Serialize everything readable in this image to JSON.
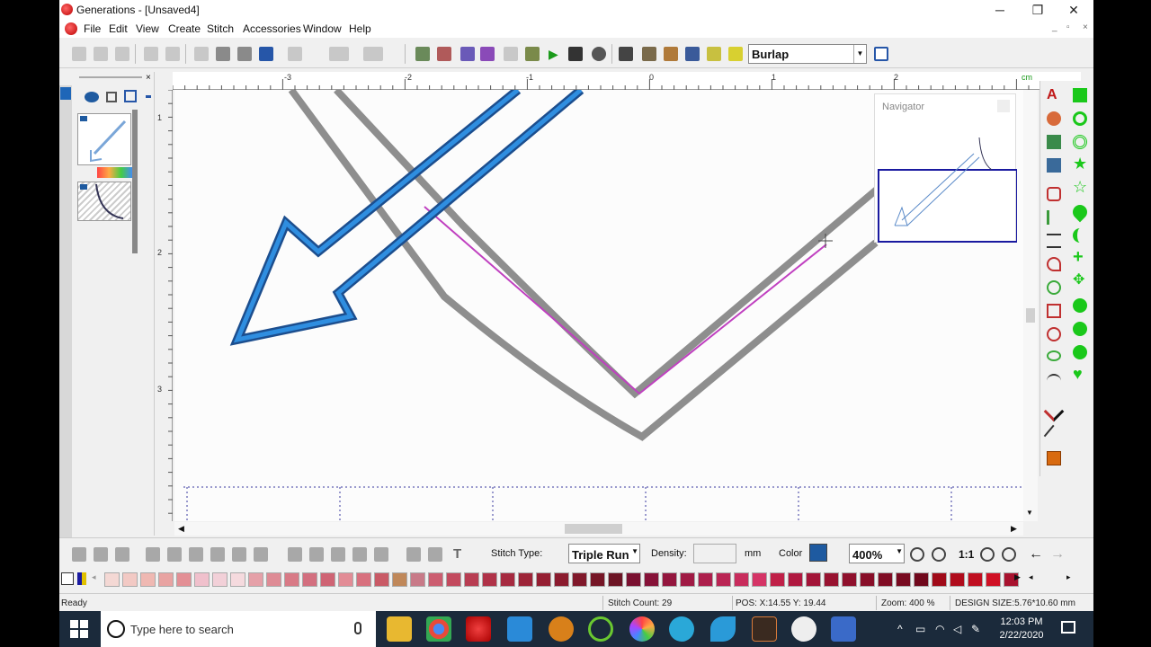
{
  "window": {
    "title": "Generations - [Unsaved4]",
    "minimize": "─",
    "maximize": "❐",
    "close": "✕"
  },
  "menu": [
    "File",
    "Edit",
    "View",
    "Create",
    "Stitch",
    "Accessories",
    "Window",
    "Help"
  ],
  "mdi_controls": [
    "_",
    "▫",
    "×"
  ],
  "toolbar": {
    "fabric_value": "Burlap"
  },
  "ruler": {
    "h_labels": [
      "-3",
      "-2",
      "-1",
      "0",
      "1",
      "2"
    ],
    "h_unit": "cm",
    "v_labels": [
      "1",
      "2",
      "3"
    ]
  },
  "navigator": {
    "title": "Navigator"
  },
  "bottom_toolbar": {
    "stitch_type_label": "Stitch Type:",
    "stitch_type_value": "Triple Run",
    "density_label": "Density:",
    "density_unit": "mm",
    "color_label": "Color",
    "zoom_value": "400%",
    "one_to_one": "1:1"
  },
  "palette": {
    "colors": [
      "#f4d8d4",
      "#f2c9c4",
      "#efb8b2",
      "#e8a3a2",
      "#e38f95",
      "#f0c0cc",
      "#f2d0d8",
      "#f5dade",
      "#e5a0a8",
      "#de8b95",
      "#d87a86",
      "#d36f7f",
      "#cf6474",
      "#e28c96",
      "#d8707e",
      "#c95a66",
      "#c0885a",
      "#c87a88",
      "#cc5d70",
      "#c34a5e",
      "#b83d52",
      "#b03248",
      "#a62a40",
      "#9d2438",
      "#951e32",
      "#8b1b2e",
      "#80182a",
      "#761626",
      "#6c1424",
      "#7a1030",
      "#861238",
      "#94163e",
      "#a01a44",
      "#ad1f4c",
      "#ba2554",
      "#c82c5c",
      "#d53466",
      "#c02048",
      "#b01840",
      "#a31438",
      "#981230",
      "#8f102c",
      "#880e28",
      "#800c24",
      "#780a20",
      "#70081c",
      "#a00a18",
      "#b00c1c",
      "#c00e20",
      "#d01024",
      "#a8122e"
    ]
  },
  "status": {
    "ready": "Ready",
    "stitch_count": "Stitch Count: 29",
    "pos": "POS: X:14.55    Y: 19.44",
    "zoom": "Zoom:  400 %",
    "design_size": "DESIGN SIZE:5.76*10.60 mm"
  },
  "taskbar": {
    "search_placeholder": "Type here to search",
    "time": "12:03 PM",
    "date": "2/22/2020"
  }
}
